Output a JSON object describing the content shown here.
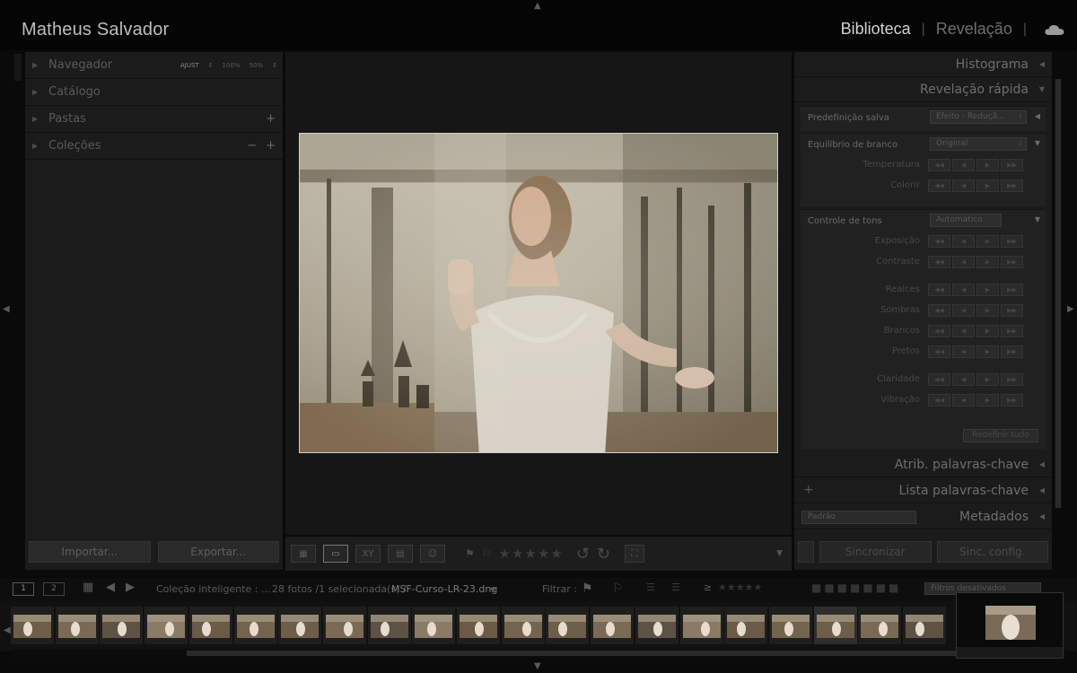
{
  "app": {
    "user_name": "Matheus Salvador",
    "modules": [
      "Biblioteca",
      "Revelação"
    ],
    "active_module": "Biblioteca",
    "cloud_icon": "cloud-icon"
  },
  "left_panel": {
    "navigator": {
      "title": "Navegador",
      "zoom_options": [
        "AJUST",
        "100%",
        "50%"
      ]
    },
    "catalog": {
      "title": "Catálogo"
    },
    "folders": {
      "title": "Pastas",
      "add": "+"
    },
    "collections": {
      "title": "Coleções",
      "remove": "−",
      "add": "+"
    },
    "import_label": "Importar...",
    "export_label": "Exportar..."
  },
  "right_panel": {
    "histogram": "Histograma",
    "quick_develop": {
      "title": "Revelação rápida",
      "saved_preset": {
        "label": "Predefinição salva",
        "value": "Efeito - Reduçã..."
      },
      "white_balance": {
        "label": "Equilíbrio de branco",
        "value": "Original"
      },
      "wb_adjust": [
        "Temperatura",
        "Colorir"
      ],
      "tone_control": {
        "label": "Controle de tons",
        "button": "Automático"
      },
      "tone_adjust_a": [
        "Exposição",
        "Contraste"
      ],
      "tone_adjust_b": [
        "Realces",
        "Sombras",
        "Brancos",
        "Pretos"
      ],
      "presence_adjust": [
        "Claridade",
        "Vibração"
      ],
      "adj_buttons": [
        "◀◀",
        "◀",
        "▶",
        "▶▶"
      ],
      "reset_label": "Redefinir tudo"
    },
    "keywording": "Atrib. palavras-chave",
    "keyword_list": "Lista palavras-chave",
    "metadata": {
      "title": "Metadados",
      "preset": "Padrão"
    },
    "sync_label": "Sincronizar",
    "sync_settings_label": "Sinc. config."
  },
  "toolbar": {
    "stars": "★★★★★"
  },
  "filmstrip": {
    "monitor_1": "1",
    "monitor_2": "2",
    "source": "Coleção inteligente : ...",
    "count_info": "28 fotos /1 selecionada(s) /",
    "filename": "MSF-Curso-LR-23.dng",
    "filter_label": "Filtrar :",
    "filter_value": "Filtros desativados",
    "selected_index": 18
  }
}
